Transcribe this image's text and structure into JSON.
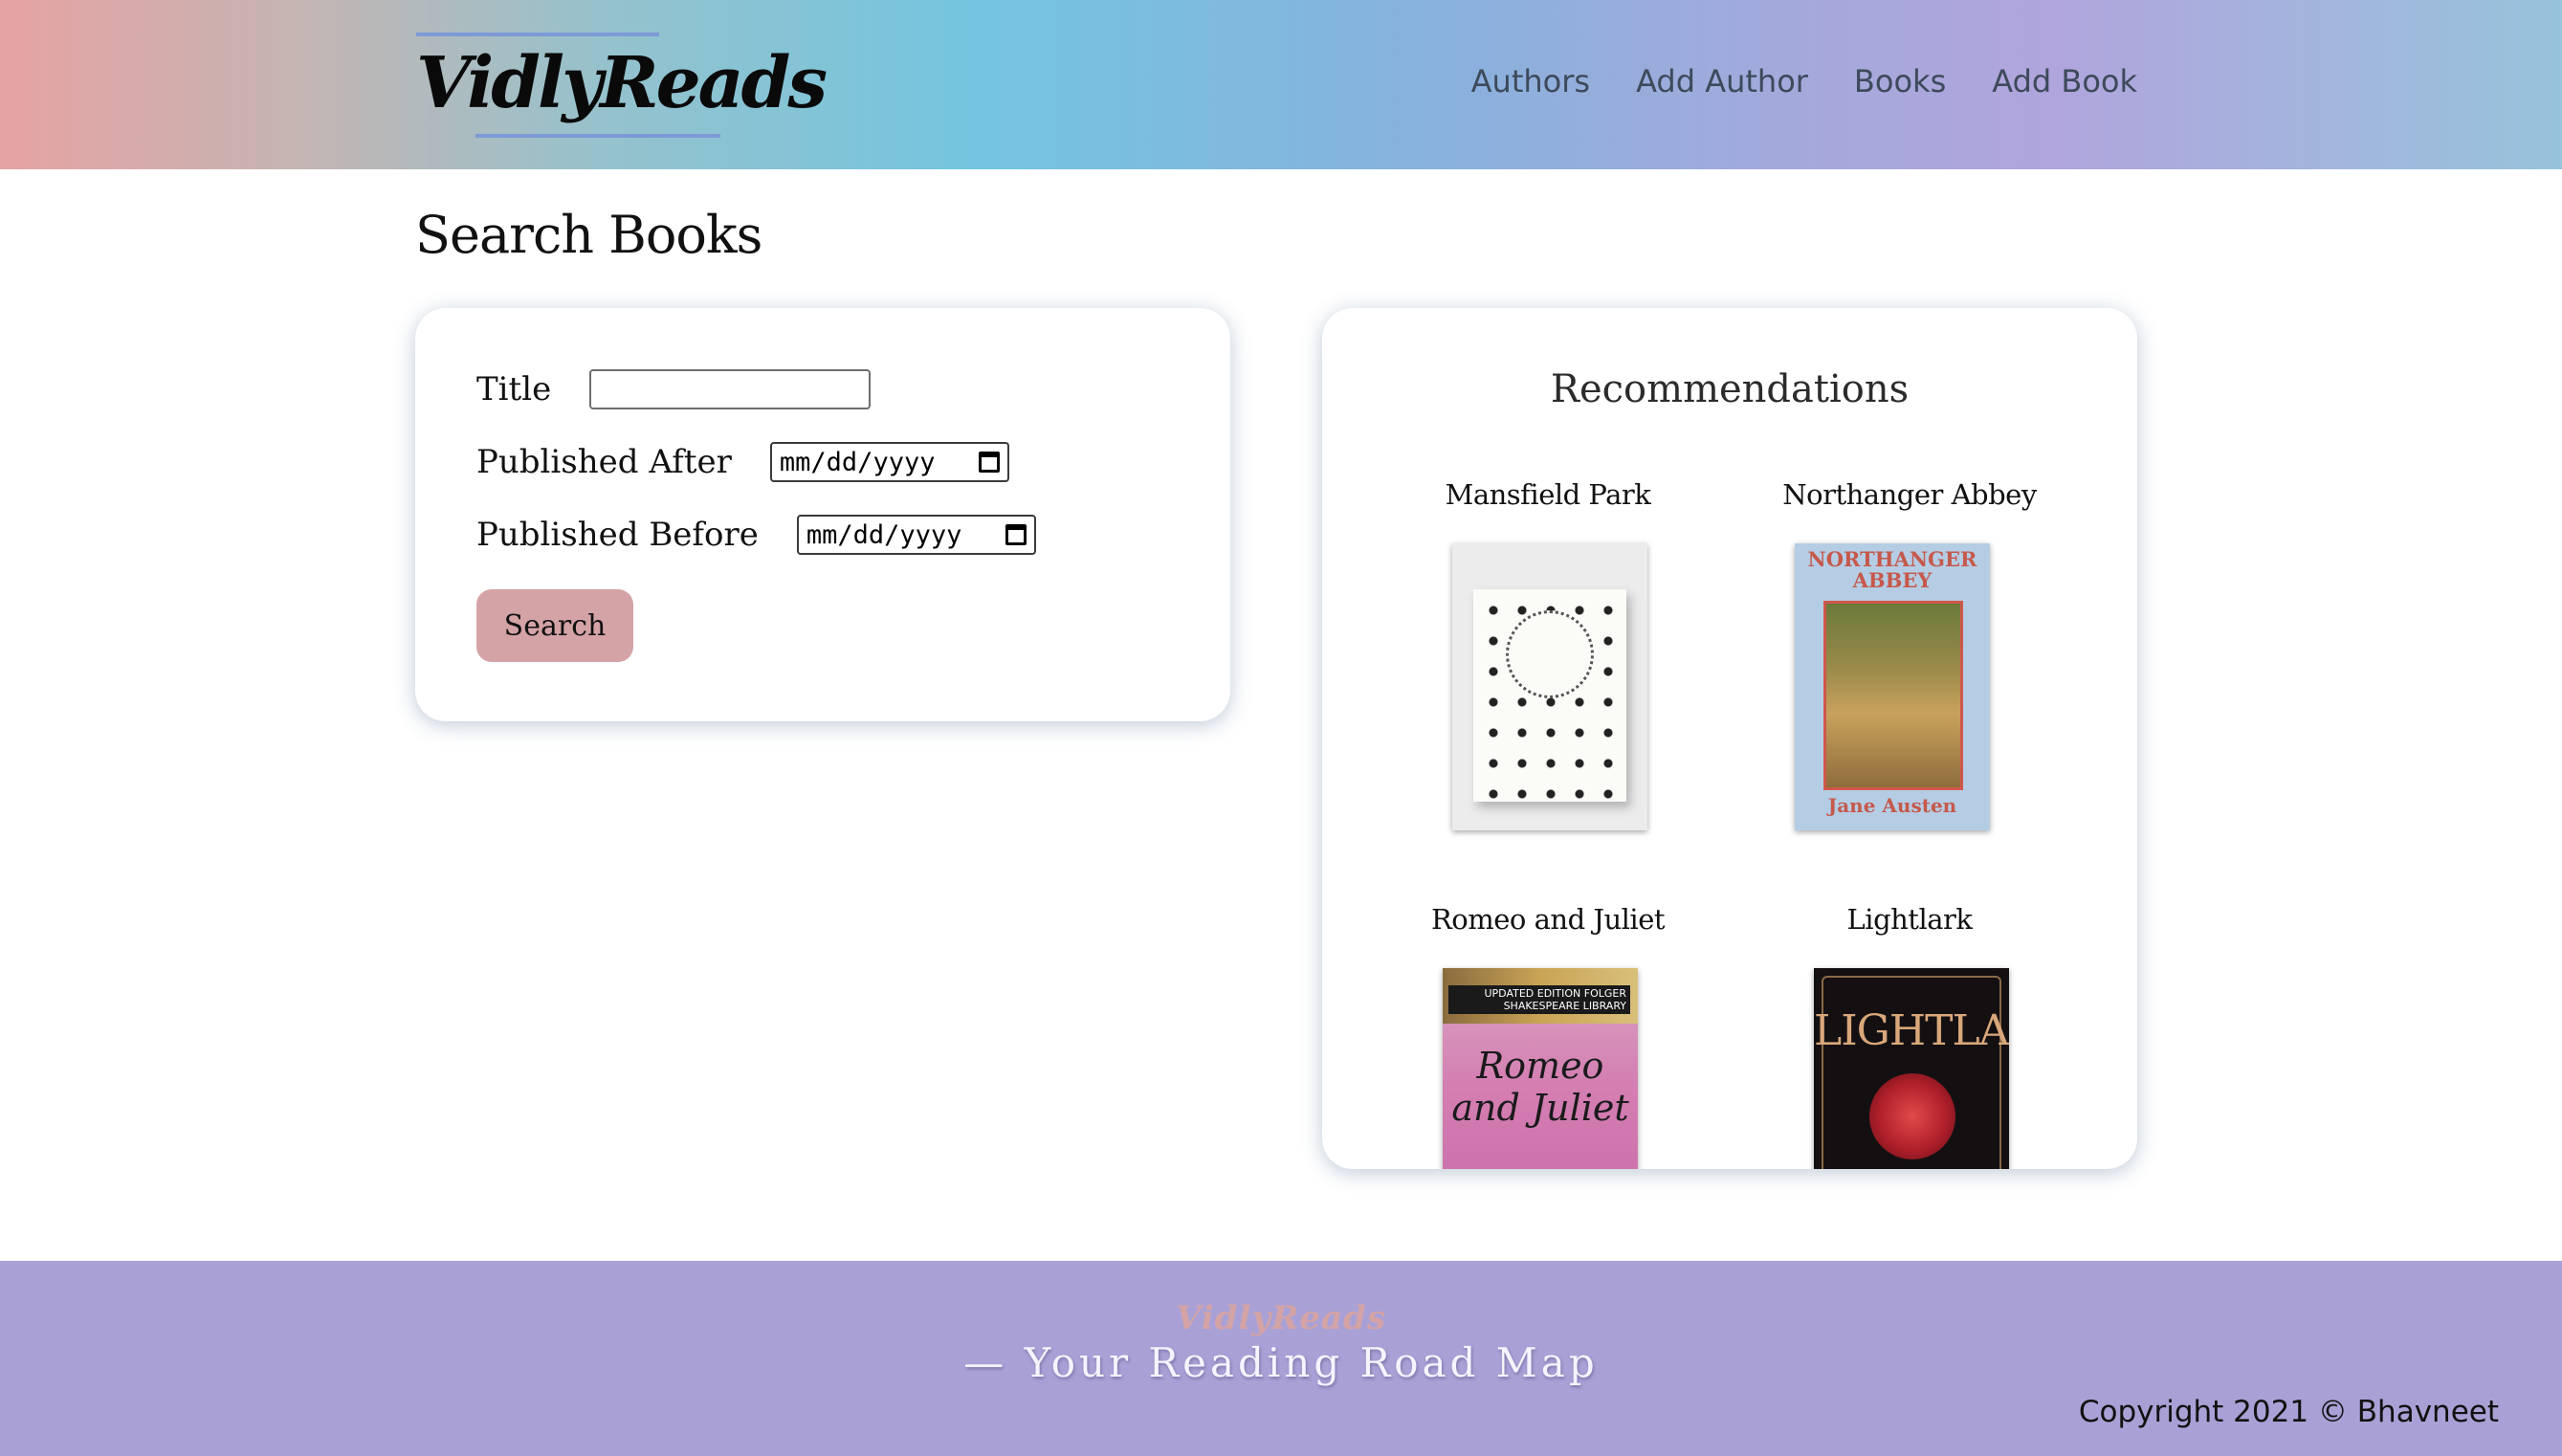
{
  "header": {
    "logo": "VidlyReads",
    "nav": [
      "Authors",
      "Add Author",
      "Books",
      "Add Book"
    ]
  },
  "page": {
    "title": "Search Books"
  },
  "search_form": {
    "title_label": "Title",
    "title_value": "",
    "published_after_label": "Published After",
    "published_after_value": "mm/dd/yyyy",
    "published_before_label": "Published Before",
    "published_before_value": "mm/dd/yyyy",
    "search_button": "Search"
  },
  "recommendations": {
    "heading": "Recommendations",
    "books": [
      {
        "title": "Mansfield Park"
      },
      {
        "title": "Northanger Abbey",
        "cover_title": "NORTHANGER ABBEY",
        "cover_author": "Jane Austen"
      },
      {
        "title": "Romeo and Juliet",
        "cover_label": "UPDATED EDITION FOLGER SHAKESPEARE LIBRARY",
        "cover_title": "Romeo and Juliet"
      },
      {
        "title": "Lightlark",
        "cover_title": "LIGHTLARK"
      }
    ]
  },
  "footer": {
    "logo": "VidlyReads",
    "tagline": "— Your Reading Road Map",
    "copyright": "Copyright 2021 © Bhavneet"
  },
  "colors": {
    "search_button": "#d4a3a6",
    "footer_bg": "#a9a1d6",
    "logo_underline": "#7d9ad6"
  }
}
